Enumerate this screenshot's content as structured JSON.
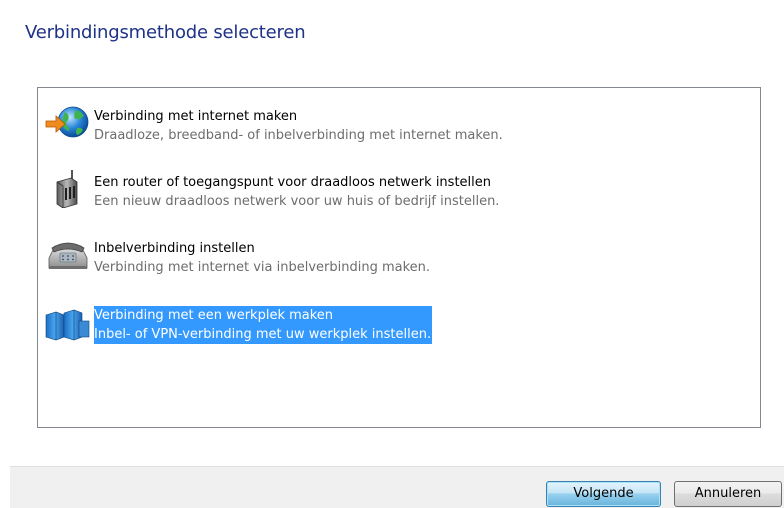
{
  "page_title": "Verbindingsmethode selecteren",
  "options": [
    {
      "title": "Verbinding met internet maken",
      "description": "Draadloze, breedband- of inbelverbinding met internet maken.",
      "icon": "globe-arrow-icon",
      "selected": false
    },
    {
      "title": "Een router of toegangspunt voor draadloos netwerk instellen",
      "description": "Een nieuw draadloos netwerk voor uw huis of bedrijf instellen.",
      "icon": "wireless-router-icon",
      "selected": false
    },
    {
      "title": "Inbelverbinding instellen",
      "description": "Verbinding met internet via inbelverbinding maken.",
      "icon": "telephone-modem-icon",
      "selected": false
    },
    {
      "title": "Verbinding met een werkplek maken",
      "description": "Inbel- of VPN-verbinding met uw werkplek instellen.",
      "icon": "workplace-network-icon",
      "selected": true
    }
  ],
  "buttons": {
    "next_label": "Volgende",
    "cancel_label": "Annuleren"
  },
  "colors": {
    "title": "#1e3287",
    "selection": "#3399ff",
    "description": "#6d6d6d"
  }
}
